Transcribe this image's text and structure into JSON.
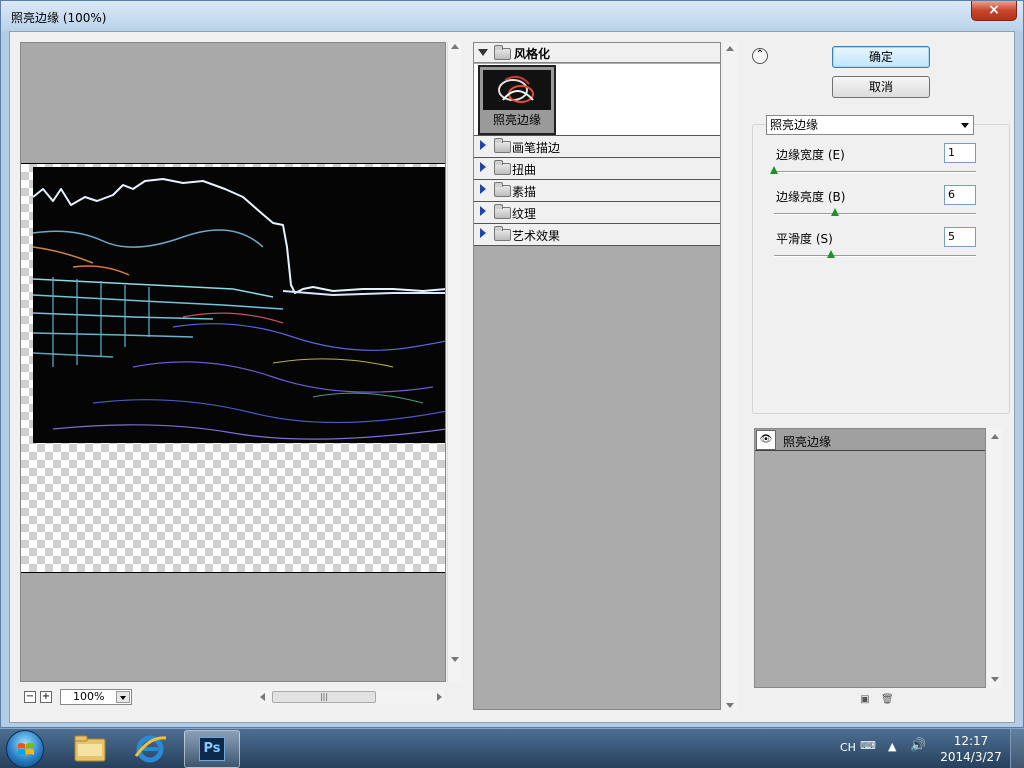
{
  "window": {
    "title": "照亮边缘 (100%)",
    "close_glyph": "×"
  },
  "preview": {
    "zoom_value": "100%",
    "zoom_out": "−",
    "zoom_in": "+",
    "hscroll_grip": "|||"
  },
  "gallery": {
    "open_category": "风格化",
    "filters": [
      {
        "label": "照亮边缘",
        "selected": true
      }
    ],
    "categories": [
      {
        "label": "画笔描边"
      },
      {
        "label": "扭曲"
      },
      {
        "label": "素描"
      },
      {
        "label": "纹理"
      },
      {
        "label": "艺术效果"
      }
    ]
  },
  "dialog": {
    "ok_label": "确定",
    "cancel_label": "取消",
    "collapse_glyph": "⌃"
  },
  "settings": {
    "selected_filter": "照亮边缘",
    "params": [
      {
        "label": "边缘宽度 (E)",
        "value": "1",
        "level_fraction": 0.0
      },
      {
        "label": "边缘亮度 (B)",
        "value": "6",
        "level_fraction": 0.3
      },
      {
        "label": "平滑度 (S)",
        "value": "5",
        "level_fraction": 0.28
      }
    ]
  },
  "layers": {
    "items": [
      {
        "label": "照亮边缘",
        "visible": true
      }
    ]
  },
  "taskbar": {
    "apps": [
      {
        "name": "windows-explorer",
        "icon": "folder-icon",
        "active": false
      },
      {
        "name": "internet-explorer",
        "icon": "ie-icon",
        "active": false
      },
      {
        "name": "photoshop",
        "icon": "ps-icon",
        "label": "Ps",
        "active": true
      }
    ],
    "language": "CH",
    "time": "12:17",
    "date": "2014/3/27"
  },
  "colors": {
    "slider_knob": "#1f8f2a",
    "primary_button": "#bee6fd",
    "taskbar": "#27405c"
  }
}
